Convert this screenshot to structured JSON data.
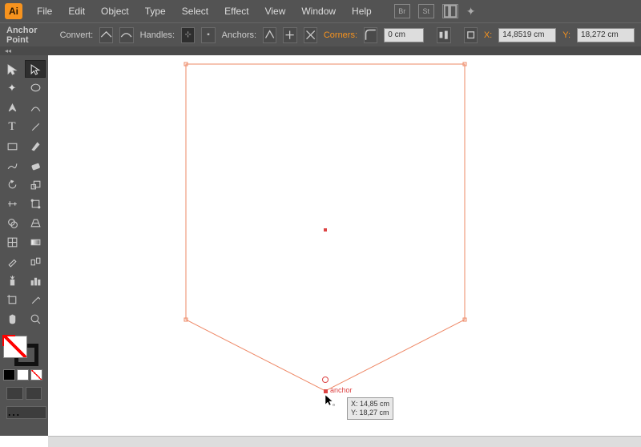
{
  "app_logo_text": "Ai",
  "menu": {
    "file": "File",
    "edit": "Edit",
    "object": "Object",
    "type": "Type",
    "select": "Select",
    "effect": "Effect",
    "view": "View",
    "window": "Window",
    "help": "Help"
  },
  "menu_icons": {
    "br": "Br",
    "st": "St"
  },
  "controlbar": {
    "mode": "Anchor Point",
    "convert": "Convert:",
    "handles": "Handles:",
    "anchors": "Anchors:",
    "corners": "Corners:",
    "corner_value": "0 cm",
    "x_label": "X:",
    "x_value": "14,8519 cm",
    "y_label": "Y:",
    "y_value": "18,272 cm"
  },
  "tab_label": "",
  "tooltip": {
    "label_anchor": "anchor",
    "x_label": "X:",
    "x_val": "14,85 cm",
    "y_label": "Y:",
    "y_val": "18,27 cm"
  }
}
